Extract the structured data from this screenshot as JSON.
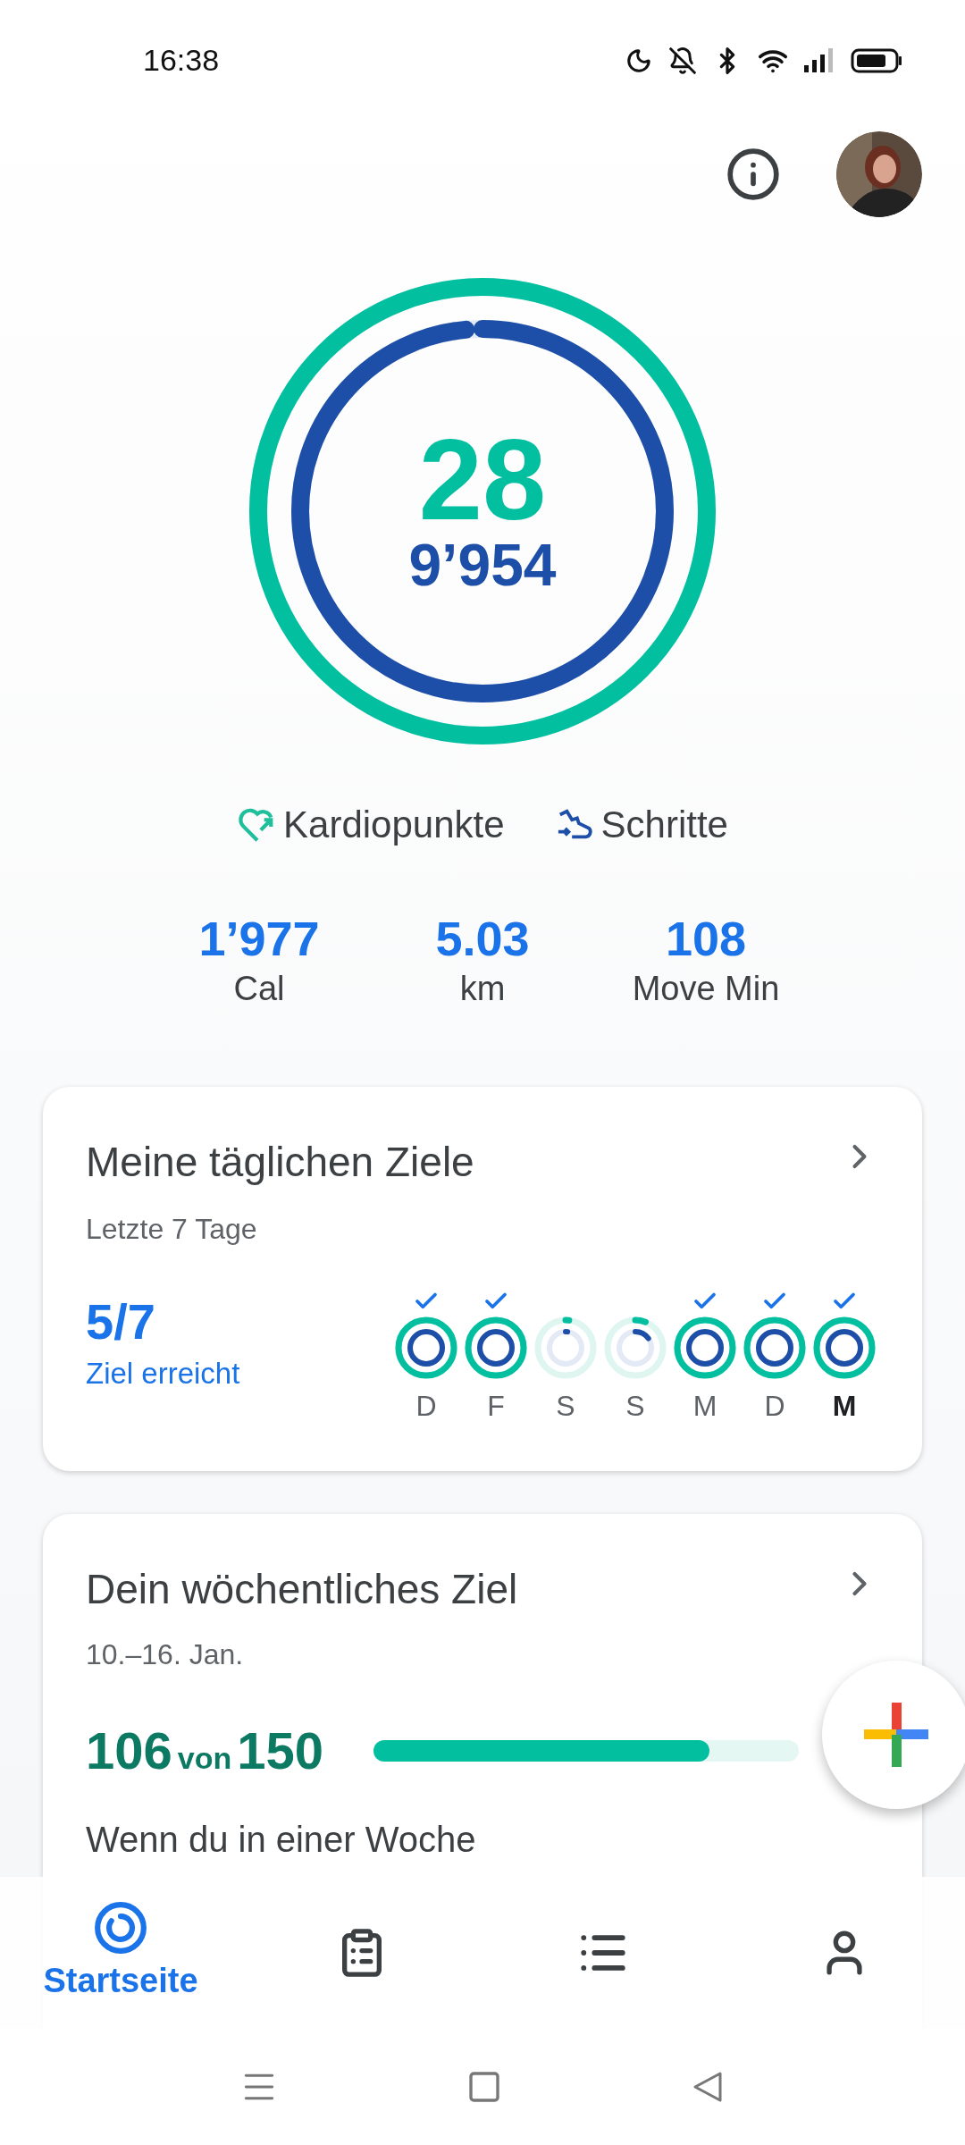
{
  "status_bar": {
    "time": "16:38"
  },
  "rings": {
    "primary": "28",
    "secondary": "9’954"
  },
  "legend": [
    {
      "label": "Kardiopunkte",
      "kind": "heart"
    },
    {
      "label": "Schritte",
      "kind": "shoe"
    }
  ],
  "stats": [
    {
      "value": "1’977",
      "label": "Cal"
    },
    {
      "value": "5.03",
      "label": "km"
    },
    {
      "value": "108",
      "label": "Move Min"
    }
  ],
  "daily_goals": {
    "title": "Meine täglichen Ziele",
    "subtitle": "Letzte 7 Tage",
    "count": "5/7",
    "count_label": "Ziel erreicht",
    "days": [
      {
        "label": "D",
        "achieved": true,
        "selected": false
      },
      {
        "label": "F",
        "achieved": true,
        "selected": false
      },
      {
        "label": "S",
        "achieved": false,
        "selected": false
      },
      {
        "label": "S",
        "achieved": false,
        "selected": false
      },
      {
        "label": "M",
        "achieved": true,
        "selected": false
      },
      {
        "label": "D",
        "achieved": true,
        "selected": false
      },
      {
        "label": "M",
        "achieved": true,
        "selected": true
      }
    ]
  },
  "weekly_goal": {
    "title": "Dein wöchentliches Ziel",
    "date_range": "10.–16. Jan.",
    "value": "106",
    "connector": "von",
    "target": "150",
    "level": 0.79,
    "description": "Wenn du in einer Woche"
  },
  "bottom_nav": [
    {
      "kind": "home",
      "label": "Startseite",
      "selected": true
    },
    {
      "kind": "journal",
      "selected": false
    },
    {
      "kind": "browse",
      "selected": false
    },
    {
      "kind": "profile",
      "selected": false
    }
  ]
}
